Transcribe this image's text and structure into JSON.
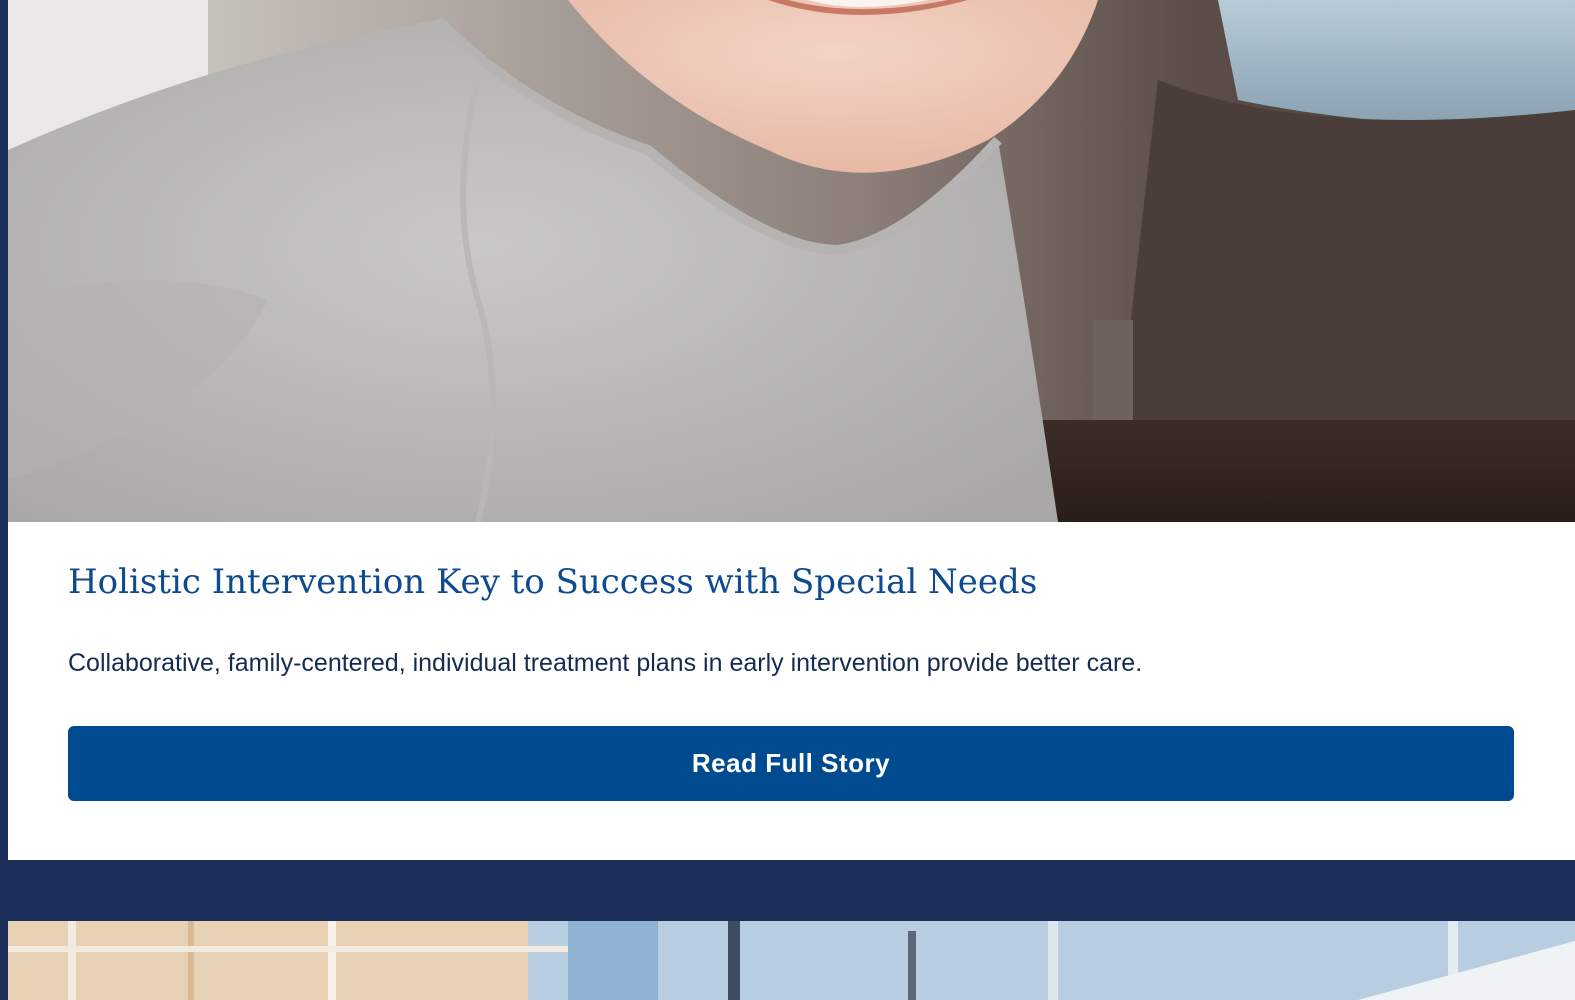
{
  "story": {
    "title": "Holistic Intervention Key to Success with Special Needs",
    "summary": "Collaborative, family-centered, individual treatment plans in early intervention provide better care.",
    "cta_label": "Read Full Story",
    "hero_image_alt": ""
  },
  "colors": {
    "page_background": "#1b2f5a",
    "card_background": "#ffffff",
    "headline": "#0d4a8f",
    "body_text": "#172a4f",
    "button": "#004a8f",
    "button_text": "#ffffff"
  }
}
